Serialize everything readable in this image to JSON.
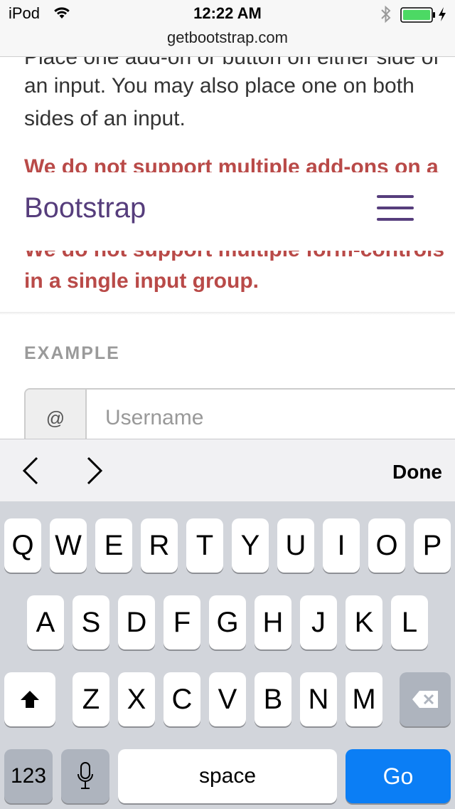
{
  "status": {
    "carrier": "iPod",
    "time": "12:22 AM",
    "wifi_icon": "wifi-icon",
    "bluetooth_icon": "bluetooth-icon",
    "battery_icon": "battery-charging-icon",
    "battery_color": "#4cd964"
  },
  "browser": {
    "url": "getbootstrap.com"
  },
  "page": {
    "cut_line": "Place one add-on or button on either side of",
    "para_line2": "an input. You may also place one on both",
    "para_line3": "sides of an input.",
    "warn_cut": "We do not support multiple add-ons on a",
    "warn_cut2": "We do not support multiple form-controls",
    "warn_line2": "in a single input group.",
    "brand": "Bootstrap",
    "brand_color": "#563d7c",
    "warning_color": "#b94a48",
    "example_label": "EXAMPLE",
    "addon": "@",
    "username_placeholder": "Username"
  },
  "accessory": {
    "prev_icon": "chevron-left-icon",
    "next_icon": "chevron-right-icon",
    "done": "Done"
  },
  "keyboard": {
    "row1": [
      "Q",
      "W",
      "E",
      "R",
      "T",
      "Y",
      "U",
      "I",
      "O",
      "P"
    ],
    "row2": [
      "A",
      "S",
      "D",
      "F",
      "G",
      "H",
      "J",
      "K",
      "L"
    ],
    "row3": [
      "Z",
      "X",
      "C",
      "V",
      "B",
      "N",
      "M"
    ],
    "shift_icon": "shift-icon",
    "delete_icon": "delete-icon",
    "mic_icon": "microphone-icon",
    "numbers": "123",
    "space": "space",
    "go": "Go",
    "go_color": "#0b7ef5"
  }
}
